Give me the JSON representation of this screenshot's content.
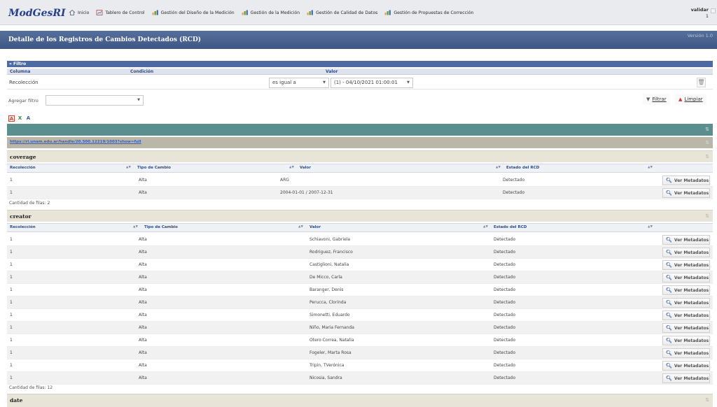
{
  "app": {
    "logo": "ModGesRI",
    "version": "Versión 1.0"
  },
  "nav": [
    {
      "label": "Inicio",
      "icon": "home-icon"
    },
    {
      "label": "Tablero de Control",
      "icon": "dashboard-icon"
    },
    {
      "label": "Gestión del Diseño de la Medición",
      "icon": "chart-icon"
    },
    {
      "label": "Gestión de la Medición",
      "icon": "chart-icon"
    },
    {
      "label": "Gestión de Calidad de Datos",
      "icon": "chart-icon"
    },
    {
      "label": "Gestión de Propuestas de Corrección",
      "icon": "chart-icon"
    }
  ],
  "user": {
    "name": "validar",
    "sub": "1"
  },
  "page": {
    "title": "Detalle de los Registros de Cambios Detectados (RCD)"
  },
  "filter": {
    "header": "Filtro",
    "columns": {
      "c1": "Columna",
      "c2": "Condición",
      "c3": "Valor"
    },
    "row": {
      "column": "Recolección",
      "condition": "es igual a",
      "value": "(1) - 04/10/2021 01:00:01"
    },
    "add_label": "Agregar filtro",
    "add_value": "",
    "filter_button": "Filtrar",
    "clear_button": "Limpiar"
  },
  "grid": {
    "top_label": "",
    "url": "https://ri.unam.edu.ar/handle/20.500.12219/1003?show=full",
    "meta_button": "Ver Metadatos",
    "sections": [
      {
        "name": "coverage",
        "columns": [
          "Recolección",
          "Tipo de Cambio",
          "Valor",
          "Estado del RCD"
        ],
        "rows": [
          {
            "rec": "1",
            "tipo": "Alta",
            "valor": "ARG",
            "estado": "Detectado"
          },
          {
            "rec": "1",
            "tipo": "Alta",
            "valor": "2004-01-01 / 2007-12-31",
            "estado": "Detectado"
          }
        ],
        "count": "Cantidad de filas: 2"
      },
      {
        "name": "creator",
        "columns": [
          "Recolección",
          "Tipo de Cambio",
          "Valor",
          "Estado del RCD"
        ],
        "rows": [
          {
            "rec": "1",
            "tipo": "Alta",
            "valor": "Schiavoni, Gabriela",
            "estado": "Detectado"
          },
          {
            "rec": "1",
            "tipo": "Alta",
            "valor": "Rodriguez, Francisco",
            "estado": "Detectado"
          },
          {
            "rec": "1",
            "tipo": "Alta",
            "valor": "Castiglioni, Natalia",
            "estado": "Detectado"
          },
          {
            "rec": "1",
            "tipo": "Alta",
            "valor": "De Micco, Carla",
            "estado": "Detectado"
          },
          {
            "rec": "1",
            "tipo": "Alta",
            "valor": "Baranger, Denis",
            "estado": "Detectado"
          },
          {
            "rec": "1",
            "tipo": "Alta",
            "valor": "Perucca, Clorinda",
            "estado": "Detectado"
          },
          {
            "rec": "1",
            "tipo": "Alta",
            "valor": "Simonetti, Eduardo",
            "estado": "Detectado"
          },
          {
            "rec": "1",
            "tipo": "Alta",
            "valor": "Niño, Maria Fernanda",
            "estado": "Detectado"
          },
          {
            "rec": "1",
            "tipo": "Alta",
            "valor": "Otero Correa, Natalia",
            "estado": "Detectado"
          },
          {
            "rec": "1",
            "tipo": "Alta",
            "valor": "Fogeler, Marta Rosa",
            "estado": "Detectado"
          },
          {
            "rec": "1",
            "tipo": "Alta",
            "valor": "Tripin, TVerónica",
            "estado": "Detectado"
          },
          {
            "rec": "1",
            "tipo": "Alta",
            "valor": "Nicosia, Sandra",
            "estado": "Detectado"
          }
        ],
        "count": "Cantidad de filas: 12"
      },
      {
        "name": "date",
        "columns": [],
        "rows": [],
        "count": ""
      }
    ]
  }
}
